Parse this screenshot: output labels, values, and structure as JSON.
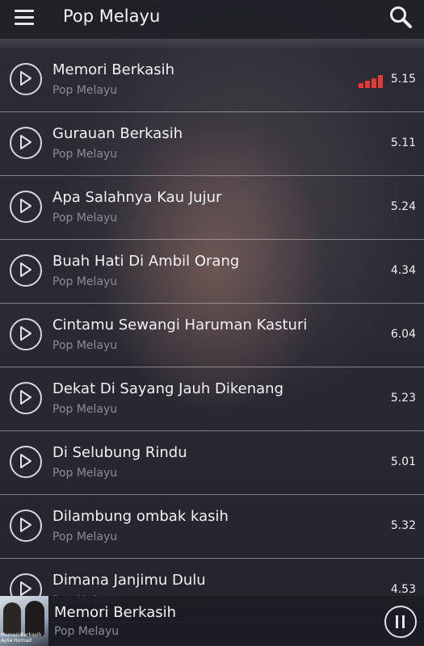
{
  "header": {
    "title": "Pop Melayu",
    "menu_icon": "hamburger-menu-icon",
    "search_icon": "search-icon"
  },
  "songs": [
    {
      "title": "Memori Berkasih",
      "artist": "Pop Melayu",
      "duration": "5.15",
      "playing": true
    },
    {
      "title": "Gurauan Berkasih",
      "artist": "Pop Melayu",
      "duration": "5.11"
    },
    {
      "title": "Apa Salahnya Kau Jujur",
      "artist": "Pop Melayu",
      "duration": "5.24"
    },
    {
      "title": "Buah Hati Di Ambil Orang",
      "artist": "Pop Melayu",
      "duration": "4.34"
    },
    {
      "title": "Cintamu Sewangi Haruman Kasturi",
      "artist": "Pop Melayu",
      "duration": "6.04"
    },
    {
      "title": "Dekat Di Sayang Jauh Dikenang",
      "artist": "Pop Melayu",
      "duration": "5.23"
    },
    {
      "title": "Di Selubung Rindu",
      "artist": "Pop Melayu",
      "duration": "5.01"
    },
    {
      "title": "Dilambung ombak kasih",
      "artist": "Pop Melayu",
      "duration": "5.32"
    },
    {
      "title": "Dimana Janjimu Dulu",
      "artist": "Pop Melayu",
      "duration": "4.53"
    }
  ],
  "now_playing": {
    "title": "Memori Berkasih",
    "artist": "Pop Melayu",
    "thumbnail_caption": "Memori Berkasih Aylie Hornad",
    "control_icon": "pause-icon"
  },
  "colors": {
    "accent": "#e53935",
    "background": "#2a2a33"
  }
}
